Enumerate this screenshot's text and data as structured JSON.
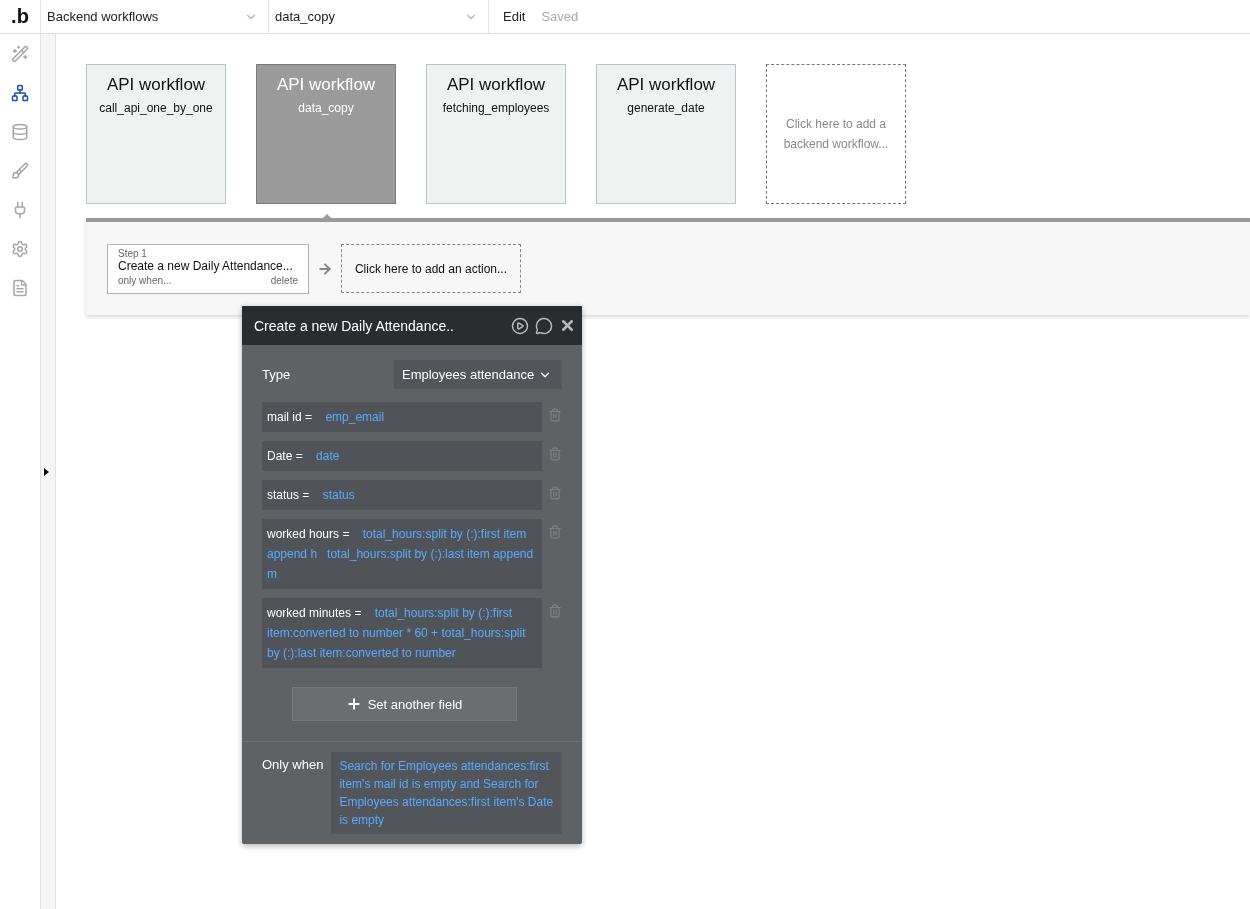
{
  "topbar": {
    "logo": ".b",
    "page_select": {
      "value": "Backend workflows"
    },
    "workflow_select": {
      "value": "data_copy"
    },
    "menu": "Edit",
    "status": "Saved"
  },
  "sidebar": {
    "items": [
      {
        "kind": "design",
        "selected": false
      },
      {
        "kind": "workflow",
        "selected": true
      },
      {
        "kind": "data",
        "selected": false
      },
      {
        "kind": "styles",
        "selected": false
      },
      {
        "kind": "plugins",
        "selected": false
      },
      {
        "kind": "settings",
        "selected": false
      },
      {
        "kind": "logs",
        "selected": false
      }
    ]
  },
  "workflows": [
    {
      "title": "API workflow",
      "name": "call_api_one_by_one",
      "selected": false
    },
    {
      "title": "API workflow",
      "name": "data_copy",
      "selected": true
    },
    {
      "title": "API workflow",
      "name": "fetching_employees",
      "selected": false
    },
    {
      "title": "API workflow",
      "name": "generate_date",
      "selected": false
    }
  ],
  "add_workflow": "Click here to add a backend workflow...",
  "steps": [
    {
      "label": "Step 1",
      "title": "Create a new Daily Attendance...",
      "condition": "only when...",
      "delete": "delete"
    }
  ],
  "add_action": "Click here to add an action...",
  "popup": {
    "title": "Create a new Daily Attendance..",
    "type_label": "Type",
    "type_value": "Employees attendance",
    "fields": [
      {
        "name": "mail id",
        "operator": "=",
        "values": [
          "emp_email"
        ]
      },
      {
        "name": "Date",
        "operator": "=",
        "values": [
          "date"
        ]
      },
      {
        "name": "status",
        "operator": "=",
        "values": [
          "status"
        ]
      },
      {
        "name": "worked hours",
        "operator": "=",
        "values": [
          "total_hours:split by (:):first item append h",
          "total_hours:split by (:):last item append m"
        ]
      },
      {
        "name": "worked minutes",
        "operator": "=",
        "values": [
          "total_hours:split by (:):first item:converted to number * 60 + total_hours:split by (:):last item:converted to number"
        ]
      }
    ],
    "add_field": "Set another field",
    "only_when_label": "Only when",
    "only_when_value": "Search for Employees attendances:first item's mail id is empty and Search for Employees attendances:first item's Date is empty"
  }
}
